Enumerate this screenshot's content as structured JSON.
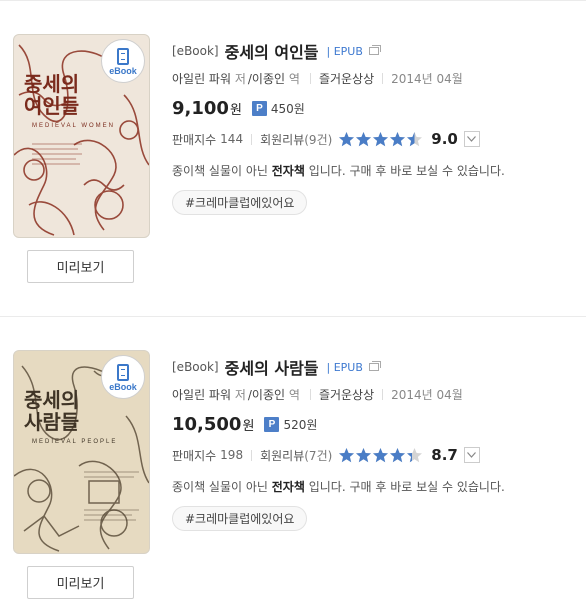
{
  "items": [
    {
      "badge": "eBook",
      "cover_title_line1": "중세의",
      "cover_title_line2": "여인들",
      "cover_subtitle": "MEDIEVAL WOMEN",
      "category": "[eBook]",
      "title": "중세의 여인들",
      "format": "EPUB",
      "author": "아일린 파워",
      "author_role": "저",
      "translator": "/이종인",
      "translator_role": "역",
      "publisher": "즐거운상상",
      "date": "2014년 04월",
      "price": "9,100",
      "currency": "원",
      "point_icon": "P",
      "points": "450원",
      "sales_label": "판매지수",
      "sales_value": "144",
      "review_label": "회원리뷰",
      "review_count": "(9건)",
      "stars": 4.5,
      "rating": "9.0",
      "desc_prefix": "종이책 실물이 아닌 ",
      "desc_bold": "전자책",
      "desc_suffix": " 입니다. 구매 후 바로 보실 수 있습니다.",
      "tag": "#크레마클럽에있어요",
      "preview_label": "미리보기"
    },
    {
      "badge": "eBook",
      "cover_title_line1": "중세의",
      "cover_title_line2": "사람들",
      "cover_subtitle": "MEDIEVAL PEOPLE",
      "category": "[eBook]",
      "title": "중세의 사람들",
      "format": "EPUB",
      "author": "아일린 파워",
      "author_role": "저",
      "translator": "/이종인",
      "translator_role": "역",
      "publisher": "즐거운상상",
      "date": "2014년 04월",
      "price": "10,500",
      "currency": "원",
      "point_icon": "P",
      "points": "520원",
      "sales_label": "판매지수",
      "sales_value": "198",
      "review_label": "회원리뷰",
      "review_count": "(7건)",
      "stars": 4.35,
      "rating": "8.7",
      "desc_prefix": "종이책 실물이 아닌 ",
      "desc_bold": "전자책",
      "desc_suffix": " 입니다. 구매 후 바로 보실 수 있습니다.",
      "tag": "#크레마클럽에있어요",
      "preview_label": "미리보기"
    }
  ],
  "colors": {
    "accent": "#3f7ad0",
    "star": "#4a7dc6",
    "star_empty": "#d4d4d4"
  }
}
